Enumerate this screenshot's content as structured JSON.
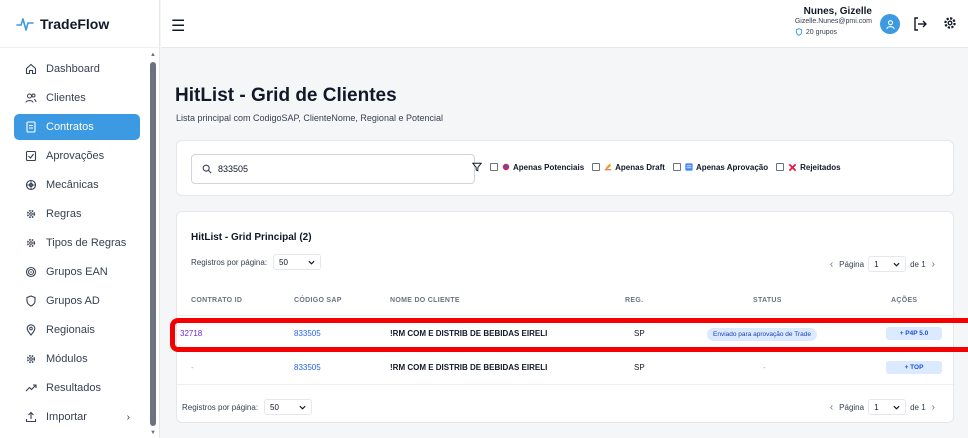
{
  "app": {
    "brand": "TradeFlow"
  },
  "sidebar": {
    "items": [
      {
        "label": "Dashboard",
        "icon": "home-icon"
      },
      {
        "label": "Clientes",
        "icon": "users-icon"
      },
      {
        "label": "Contratos",
        "icon": "document-icon",
        "active": true
      },
      {
        "label": "Aprovações",
        "icon": "check-square-icon"
      },
      {
        "label": "Mecânicas",
        "icon": "cog-icon"
      },
      {
        "label": "Regras",
        "icon": "gear-icon"
      },
      {
        "label": "Tipos de Regras",
        "icon": "gear-icon"
      },
      {
        "label": "Grupos EAN",
        "icon": "target-icon"
      },
      {
        "label": "Grupos AD",
        "icon": "shield-icon"
      },
      {
        "label": "Regionais",
        "icon": "map-pin-icon"
      },
      {
        "label": "Módulos",
        "icon": "gear-icon"
      },
      {
        "label": "Resultados",
        "icon": "trend-icon"
      },
      {
        "label": "Importar",
        "icon": "upload-icon",
        "chevron": "›"
      }
    ]
  },
  "topbar": {
    "user_name": "Nunes, Gizelle",
    "user_email": "Gizelle.Nunes@pmi.com",
    "user_groups": "20 grupos"
  },
  "page": {
    "title": "HitList - Grid de Clientes",
    "subtitle": "Lista principal com CodigoSAP, ClienteNome, Regional e Potencial"
  },
  "filters": {
    "search_value": "833505",
    "options": [
      {
        "label": "Apenas Potenciais",
        "icon": "potential-icon"
      },
      {
        "label": "Apenas Draft",
        "icon": "draft-icon"
      },
      {
        "label": "Apenas Aprovação",
        "icon": "approval-icon"
      },
      {
        "label": "Rejeitados",
        "icon": "reject-icon"
      }
    ]
  },
  "grid": {
    "title": "HitList - Grid Principal (2)",
    "per_page_label": "Registros por página:",
    "per_page_value": "50",
    "page_label": "Página",
    "page_value": "1",
    "page_of": "de 1",
    "columns": [
      "CONTRATO ID",
      "CÓDIGO SAP",
      "NOME DO CLIENTE",
      "REG.",
      "STATUS",
      "AÇÕES"
    ],
    "rows": [
      {
        "contrato": "32718",
        "sap": "833505",
        "cliente": "!RM COM E DISTRIB DE BEBIDAS EIRELI",
        "reg": "SP",
        "status": "Enviado para aprovação de Trade",
        "acao": "+ P4P 5.0"
      },
      {
        "contrato": "-",
        "sap": "833505",
        "cliente": "!RM COM E DISTRIB DE BEBIDAS EIRELI",
        "reg": "SP",
        "status": "-",
        "acao": "+ TOP"
      }
    ]
  },
  "colors": {
    "accent": "#3b9ae1",
    "highlight": "#f40000",
    "link": "#6d28d9"
  }
}
